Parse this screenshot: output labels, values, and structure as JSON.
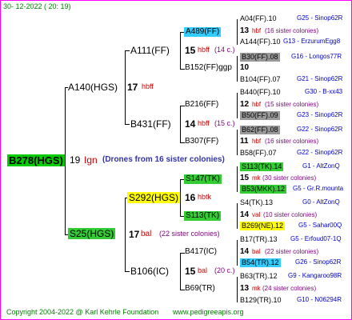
{
  "colors": {
    "frame_border": "#ff00ff",
    "root_bg": "#00cc00",
    "green_bg": "#33cc33",
    "yellow_bg": "#ffff00",
    "cyan_bg": "#33ccff",
    "gray_bg": "#999999",
    "link_blue": "#0000cc",
    "note_purple": "#7f007f",
    "text_red": "#cc0000",
    "footer_green": "#008000"
  },
  "header": {
    "date": "30- 12-2022 ( 20: 19)"
  },
  "root": {
    "name": "B278(HGS)",
    "year": "19",
    "breeder": "Ign",
    "note": "(Drones from 16 sister colonies)"
  },
  "gen1": [
    {
      "name": "A140(HGS)",
      "year": "17",
      "breeder": "hbff",
      "note": ""
    },
    {
      "name": "S25(HGS)",
      "year": "17",
      "breeder": "bal",
      "note": "(22 sister colonies)"
    }
  ],
  "gen2": [
    {
      "name": "A111(FF)",
      "year": "15",
      "breeder": "hbff",
      "note": "(14 c.)"
    },
    {
      "name": "B152(FF)ggp",
      "year": "",
      "breeder": "",
      "note": ""
    },
    {
      "name": "B216(FF)",
      "year": "14",
      "breeder": "hbff",
      "note": "(15 c.)"
    },
    {
      "name": "B431(FF)",
      "year": "",
      "breeder": "",
      "note": ""
    },
    {
      "name": "B307(FF)",
      "year": "",
      "breeder": "",
      "note": ""
    },
    {
      "name": "S292(HGS)",
      "year": "16",
      "breeder": "hbtk",
      "note": ""
    },
    {
      "name": "B417(IC)",
      "year": "15",
      "breeder": "bal",
      "note": "(20 c.)"
    },
    {
      "name": "B106(IC)",
      "year": "",
      "breeder": "",
      "note": ""
    },
    {
      "name": "B69(TR)",
      "year": "",
      "breeder": "",
      "note": ""
    }
  ],
  "gen3": [
    {
      "name": "A489(FF)",
      "left": "",
      "right": ""
    },
    {
      "name": "S147(TK)",
      "left": "",
      "right": ""
    },
    {
      "name": "S113(TK)",
      "left": "",
      "right": ""
    }
  ],
  "entries": [
    {
      "name": "A04(FF).10",
      "link": "G25 - Sinop62R",
      "year": "",
      "breeder": "",
      "note": ""
    },
    {
      "name": "",
      "link": "",
      "year": "13",
      "breeder": "hbf",
      "note": "(16 sister colonies)"
    },
    {
      "name": "A144(FF).10",
      "link": "G13 - ErzurumEgg8",
      "year": "",
      "breeder": "",
      "note": ""
    },
    {
      "name": "B30(FF).08",
      "link": "G16 - Longos77R",
      "year": "",
      "breeder": "",
      "note": ""
    },
    {
      "name": "",
      "link": "",
      "year": "10",
      "breeder": "",
      "note": ""
    },
    {
      "name": "B104(FF).07",
      "link": "G21 - Sinop62R",
      "year": "",
      "breeder": "",
      "note": ""
    },
    {
      "name": "B440(FF).10",
      "link": "G30 - B-xx43",
      "year": "",
      "breeder": "",
      "note": ""
    },
    {
      "name": "",
      "link": "",
      "year": "12",
      "breeder": "hbf",
      "note": "(15 sister colonies)"
    },
    {
      "name": "B50(FF).09",
      "link": "G23 - Sinop62R",
      "year": "",
      "breeder": "",
      "note": ""
    },
    {
      "name": "B62(FF).08",
      "link": "G22 - Sinop62R",
      "year": "",
      "breeder": "",
      "note": ""
    },
    {
      "name": "",
      "link": "",
      "year": "11",
      "breeder": "hbf",
      "note": "(16 sister colonies)"
    },
    {
      "name": "B58(FF).07",
      "link": "G22 - Sinop62R",
      "year": "",
      "breeder": "",
      "note": ""
    },
    {
      "name": "S113(TK).14",
      "link": "G1 - AltZonQ",
      "year": "",
      "breeder": "",
      "note": ""
    },
    {
      "name": "",
      "link": "",
      "year": "15",
      "breeder": "mk",
      "note": "(30 sister colonies)"
    },
    {
      "name": "B53(MKK).12",
      "link": "G5 - Gr.R.mounta",
      "year": "",
      "breeder": "",
      "note": ""
    },
    {
      "name": "S4(TK).13",
      "link": "G0 - AltZonQ",
      "year": "",
      "breeder": "",
      "note": ""
    },
    {
      "name": "",
      "link": "",
      "year": "14",
      "breeder": "val",
      "note": "(10 sister colonies)"
    },
    {
      "name": "B269(NE).12",
      "link": "G5 - Sahar00Q",
      "year": "",
      "breeder": "",
      "note": ""
    },
    {
      "name": "B17(TR).13",
      "link": "G5 - Erfoud07-1Q",
      "year": "",
      "breeder": "",
      "note": ""
    },
    {
      "name": "",
      "link": "",
      "year": "14",
      "breeder": "bal",
      "note": "(22 sister colonies)"
    },
    {
      "name": "B54(TR).12",
      "link": "G26 - Sinop62R",
      "year": "",
      "breeder": "",
      "note": ""
    },
    {
      "name": "B63(TR).12",
      "link": "G9 - Kangaroo98R",
      "year": "",
      "breeder": "",
      "note": ""
    },
    {
      "name": "",
      "link": "",
      "year": "13",
      "breeder": "mk",
      "note": "(24 sister colonies)"
    },
    {
      "name": "B129(TR).10",
      "link": "G10 - N06294R",
      "year": "",
      "breeder": "",
      "note": ""
    }
  ],
  "footer": {
    "copyright": "Copyright 2004-2022 @ Karl Kehrle Foundation",
    "url": "www.pedigreeapis.org"
  }
}
